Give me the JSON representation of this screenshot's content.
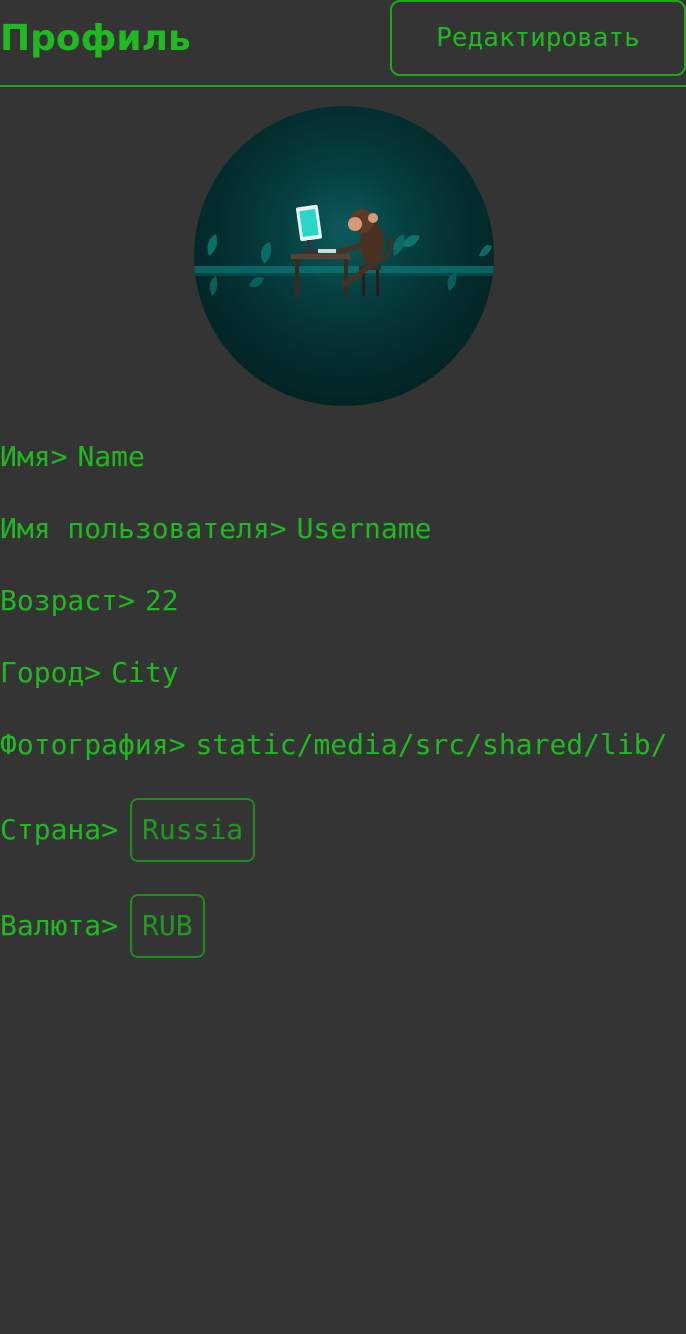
{
  "header": {
    "title": "Профиль",
    "edit_label": "Редактировать"
  },
  "avatar": {
    "icon": "monkey-at-computer-illustration"
  },
  "profile": {
    "name_label": "Имя>",
    "name_value": "Name",
    "username_label": "Имя пользователя>",
    "username_value": "Username",
    "age_label": "Возраст>",
    "age_value": "22",
    "city_label": "Город>",
    "city_value": "City",
    "photo_label": "Фотография>",
    "photo_value": "static/media/src/shared/lib/",
    "country_label": "Страна>",
    "country_value": "Russia",
    "currency_label": "Валюта>",
    "currency_value": "RUB"
  },
  "colors": {
    "background": "#343434",
    "accent": "#1fba1f"
  }
}
